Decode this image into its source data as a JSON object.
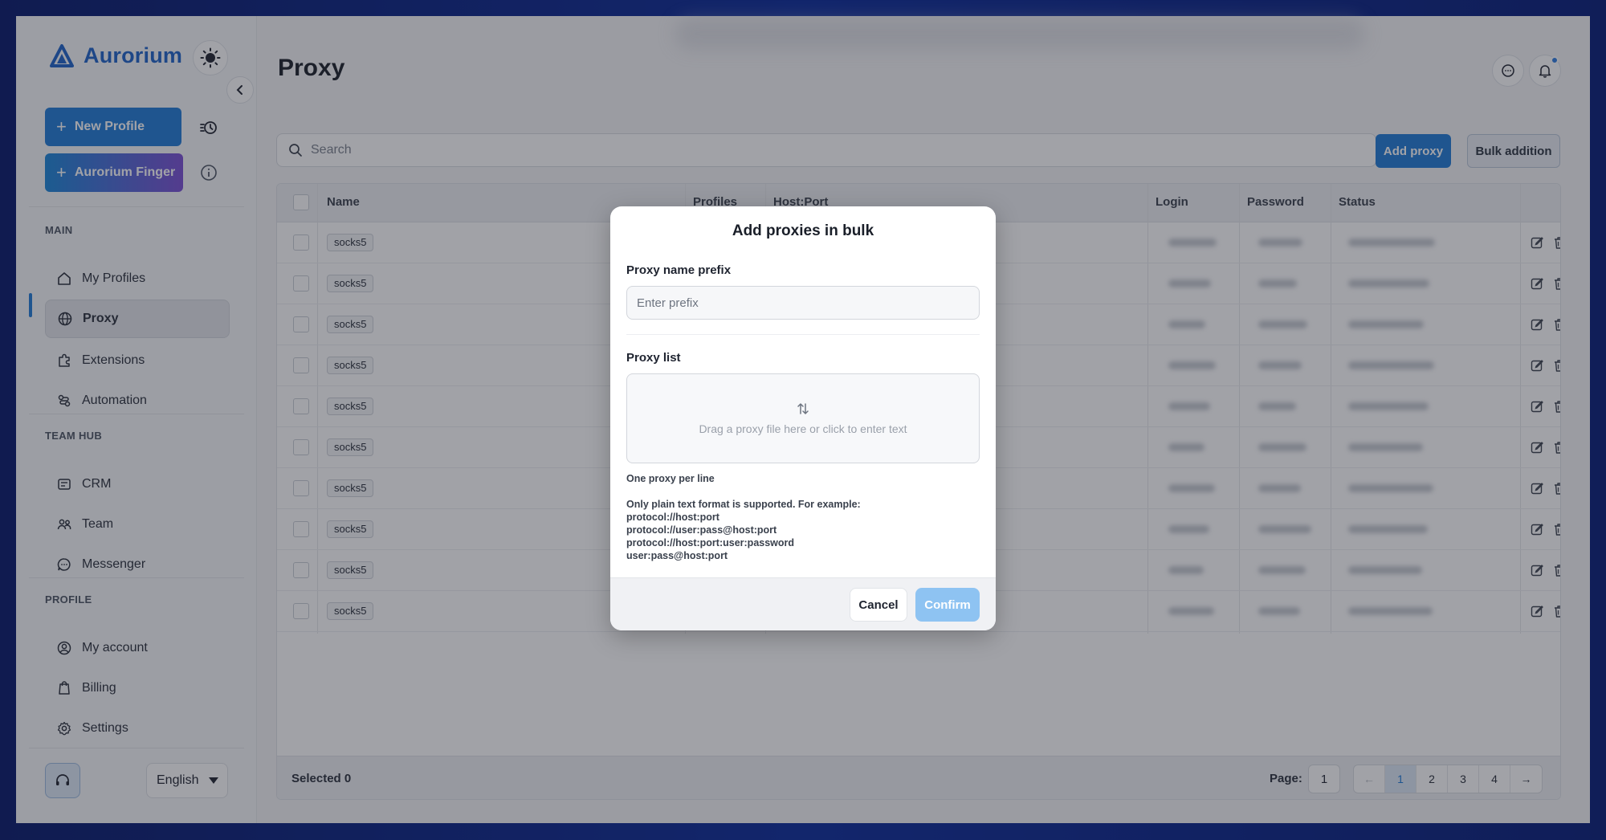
{
  "app": {
    "name": "Aurorium"
  },
  "sidebar": {
    "new_profile_label": "New Profile",
    "finger_label": "Aurorium Finger",
    "sections": {
      "main": "MAIN",
      "team_hub": "TEAM HUB",
      "profile": "PROFILE"
    },
    "main_items": [
      {
        "label": "My Profiles",
        "icon": "home-icon"
      },
      {
        "label": "Proxy",
        "icon": "globe-icon",
        "active": true
      },
      {
        "label": "Extensions",
        "icon": "puzzle-icon"
      },
      {
        "label": "Automation",
        "icon": "automation-icon"
      }
    ],
    "team_items": [
      {
        "label": "CRM",
        "icon": "crm-icon"
      },
      {
        "label": "Team",
        "icon": "team-icon"
      },
      {
        "label": "Messenger",
        "icon": "chat-icon"
      }
    ],
    "profile_items": [
      {
        "label": "My account",
        "icon": "user-icon"
      },
      {
        "label": "Billing",
        "icon": "billing-icon"
      },
      {
        "label": "Settings",
        "icon": "gear-icon"
      }
    ],
    "language": "English"
  },
  "page": {
    "title": "Proxy",
    "search_placeholder": "Search",
    "add_proxy_label": "Add proxy",
    "bulk_addition_label": "Bulk addition"
  },
  "table": {
    "headers": {
      "name": "Name",
      "profiles": "Profiles",
      "host_port": "Host:Port",
      "login": "Login",
      "password": "Password",
      "status": "Status"
    },
    "rows": [
      {
        "type": "socks5"
      },
      {
        "type": "socks5"
      },
      {
        "type": "socks5"
      },
      {
        "type": "socks5"
      },
      {
        "type": "socks5"
      },
      {
        "type": "socks5"
      },
      {
        "type": "socks5"
      },
      {
        "type": "socks5"
      },
      {
        "type": "socks5"
      },
      {
        "type": "socks5"
      }
    ],
    "footer": {
      "selected_text": "Selected 0",
      "page_label": "Page:",
      "page_value": "1",
      "pages": [
        "1",
        "2",
        "3",
        "4"
      ],
      "current_page": "1",
      "prev_glyph": "←",
      "next_glyph": "→"
    }
  },
  "modal": {
    "title": "Add proxies in bulk",
    "prefix_label": "Proxy name prefix",
    "prefix_placeholder": "Enter prefix",
    "list_label": "Proxy list",
    "dropzone_text": "Drag a proxy file here or click to enter text",
    "hint_per_line": "One proxy per line",
    "hint_format_title": "Only plain text format is supported. For example:",
    "hint_examples": [
      "protocol://host:port",
      "protocol://user:pass@host:port",
      "protocol://host:port:user:password",
      "user:pass@host:port"
    ],
    "cancel_label": "Cancel",
    "confirm_label": "Confirm"
  },
  "colors": {
    "accent": "#1f7ad6",
    "confirm_disabled": "#8ec3f2",
    "frame_background": "#06186a"
  }
}
